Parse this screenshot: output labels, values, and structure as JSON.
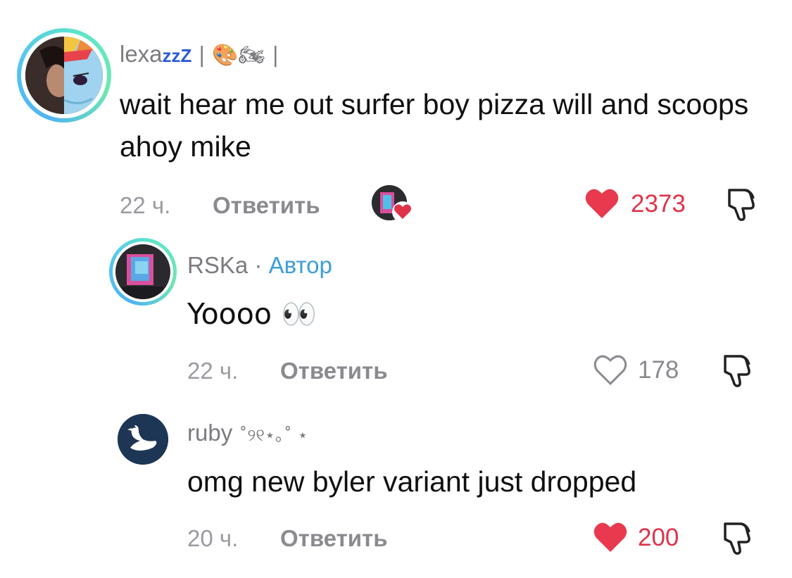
{
  "comments": [
    {
      "username": "lexa",
      "name_decor": "zzZ",
      "badges": "| 🎨🏍 |",
      "text": "wait hear me out surfer boy pizza will and scoops ahoy mike",
      "time": "22 ч.",
      "reply_label": "Ответить",
      "likes": "2373",
      "liked": true,
      "avatar_icon": "profile-photo",
      "creator_liked": true
    },
    {
      "username": "RSKa",
      "separator": "·",
      "author_label": "Автор",
      "text": "Yoooo 👀",
      "time": "22 ч.",
      "reply_label": "Ответить",
      "likes": "178",
      "liked": false,
      "avatar_icon": "profile-photo"
    },
    {
      "username": "ruby",
      "name_decor": "˚୨୧⋆｡˚ ⋆",
      "text": "omg new byler variant just dropped",
      "time": "20 ч.",
      "reply_label": "Ответить",
      "likes": "200",
      "liked": true,
      "avatar_icon": "swan-icon"
    }
  ],
  "colors": {
    "like_active": "#e0334a",
    "author_accent": "#3b9fd6",
    "muted_text": "#8a8a90"
  }
}
